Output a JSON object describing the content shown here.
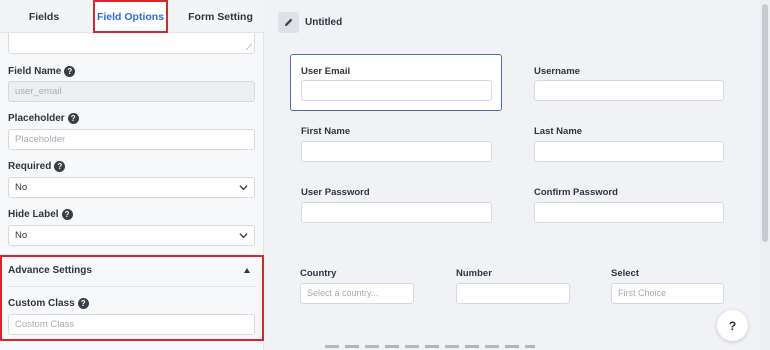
{
  "tabs": {
    "fields": "Fields",
    "field_options": "Field Options",
    "form_setting": "Form Setting"
  },
  "options": {
    "field_name_label": "Field Name",
    "field_name_value": "user_email",
    "placeholder_label": "Placeholder",
    "placeholder_hint": "Placeholder",
    "required_label": "Required",
    "required_value": "No",
    "hide_label_label": "Hide Label",
    "hide_label_value": "No",
    "help_glyph": "?"
  },
  "advance": {
    "title": "Advance Settings",
    "custom_class_label": "Custom Class",
    "custom_class_hint": "Custom Class"
  },
  "editor": {
    "title": "Untitled",
    "fields": {
      "user_email": "User Email",
      "username": "Username",
      "first_name": "First Name",
      "last_name": "Last Name",
      "user_password": "User Password",
      "confirm_password": "Confirm Password",
      "country": "Country",
      "country_hint": "Select a country...",
      "number": "Number",
      "select": "Select",
      "select_hint": "First Choice"
    },
    "help_fab": "?"
  },
  "colors": {
    "accent": "#2f6ad9",
    "highlight": "#d7262b",
    "selected_border": "#4f6fbd"
  }
}
